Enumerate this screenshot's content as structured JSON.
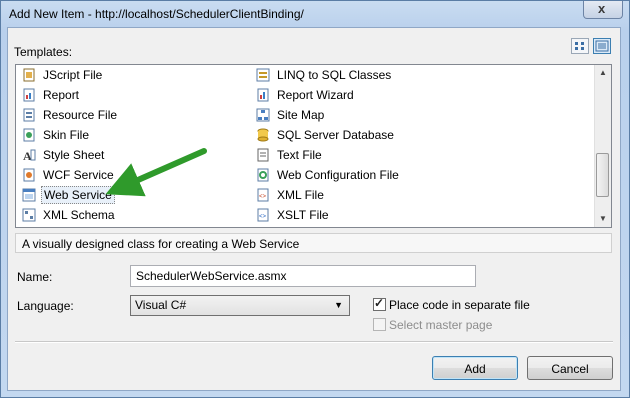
{
  "window": {
    "title": "Add New Item - http://localhost/SchedulerClientBinding/",
    "close_symbol": "x"
  },
  "templates": {
    "label": "Templates:",
    "left_column": [
      {
        "label": "JScript File",
        "icon": "script-file-icon"
      },
      {
        "label": "Report",
        "icon": "report-icon"
      },
      {
        "label": "Resource File",
        "icon": "resource-file-icon"
      },
      {
        "label": "Skin File",
        "icon": "skin-file-icon"
      },
      {
        "label": "Style Sheet",
        "icon": "style-sheet-icon"
      },
      {
        "label": "WCF Service",
        "icon": "wcf-service-icon"
      },
      {
        "label": "Web Service",
        "icon": "web-service-icon",
        "selected": true
      },
      {
        "label": "XML Schema",
        "icon": "xml-schema-icon"
      }
    ],
    "right_column": [
      {
        "label": "LINQ to SQL Classes",
        "icon": "linq-icon"
      },
      {
        "label": "Report Wizard",
        "icon": "report-wizard-icon"
      },
      {
        "label": "Site Map",
        "icon": "site-map-icon"
      },
      {
        "label": "SQL Server Database",
        "icon": "database-icon"
      },
      {
        "label": "Text File",
        "icon": "text-file-icon"
      },
      {
        "label": "Web Configuration File",
        "icon": "web-config-icon"
      },
      {
        "label": "XML File",
        "icon": "xml-file-icon"
      },
      {
        "label": "XSLT File",
        "icon": "xslt-file-icon"
      }
    ]
  },
  "description": "A visually designed class for creating a Web Service",
  "form": {
    "name_label": "Name:",
    "name_value": "SchedulerWebService.asmx",
    "language_label": "Language:",
    "language_value": "Visual C#",
    "place_code_label": "Place code in separate file",
    "place_code_checked": true,
    "master_page_label": "Select master page",
    "master_page_checked": false
  },
  "buttons": {
    "add": "Add",
    "cancel": "Cancel"
  },
  "colors": {
    "annotation_arrow": "#2f9a2b",
    "selection": "#e8f0f9",
    "title_bar": "#c9dcf1"
  }
}
